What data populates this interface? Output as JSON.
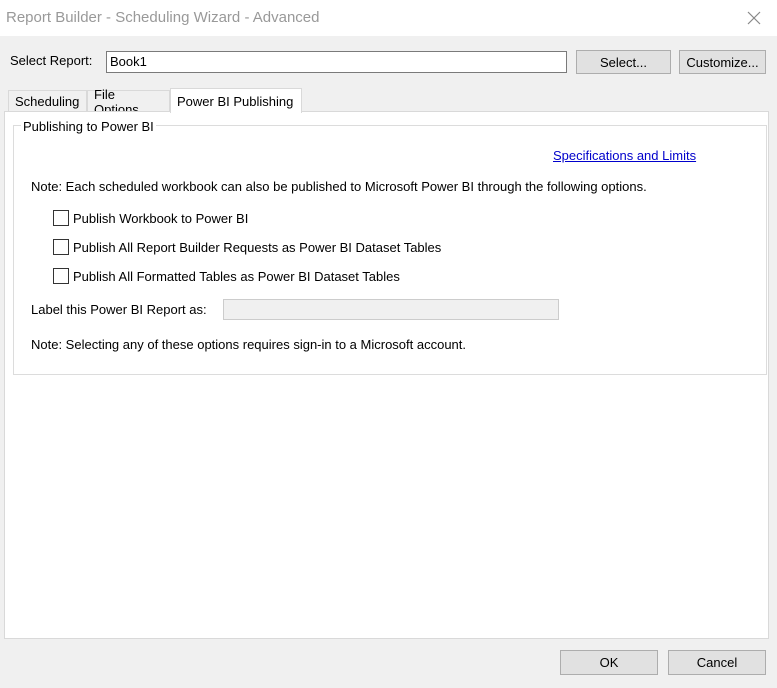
{
  "window": {
    "title": "Report Builder - Scheduling Wizard - Advanced",
    "close_icon": "close-x-icon"
  },
  "report": {
    "label": "Select Report:",
    "value": "Book1",
    "select_button": "Select...",
    "customize_button": "Customize..."
  },
  "tabs": [
    {
      "label": "Scheduling",
      "active": false
    },
    {
      "label": "File Options",
      "active": false
    },
    {
      "label": "Power BI Publishing",
      "active": true
    }
  ],
  "publishing": {
    "group_title": "Publishing to Power BI",
    "spec_link": "Specifications and Limits",
    "note_top": "Note: Each scheduled workbook can also be published to Microsoft Power BI through the following options.",
    "options": [
      {
        "label": "Publish Workbook to Power BI",
        "checked": false
      },
      {
        "label": "Publish All Report Builder Requests as Power BI Dataset Tables",
        "checked": false
      },
      {
        "label": "Publish All Formatted Tables as Power BI Dataset Tables",
        "checked": false
      }
    ],
    "label_field": {
      "label": "Label this Power BI Report as:",
      "value": ""
    },
    "note_bottom": "Note: Selecting any of these options requires sign-in to a Microsoft account."
  },
  "footer": {
    "ok_button": "OK",
    "cancel_button": "Cancel"
  },
  "colors": {
    "window_bg": "#f0f0f0",
    "link": "#0000cc",
    "title_text": "#999999"
  }
}
